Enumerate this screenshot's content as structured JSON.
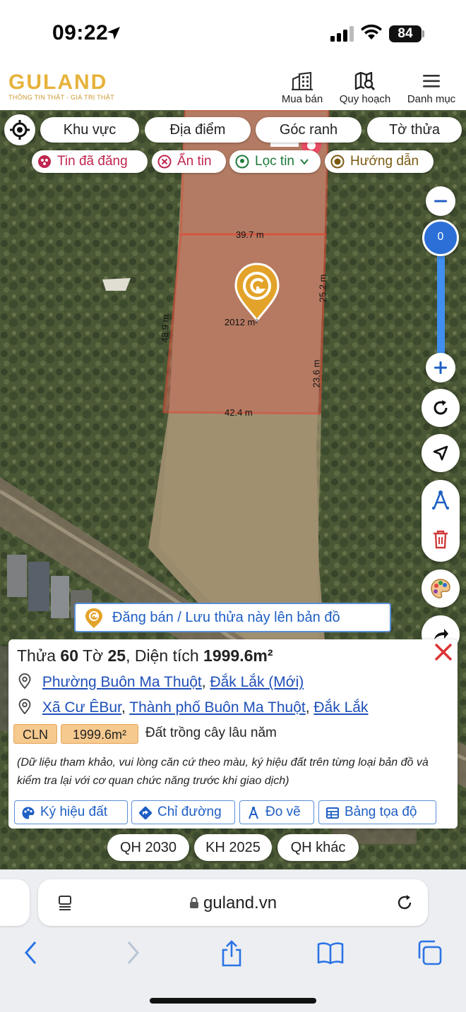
{
  "status": {
    "time": "09:22",
    "battery": "84"
  },
  "header": {
    "logo": "GULAND",
    "tagline": "THÔNG TIN THẬT - GIÁ TRỊ THẬT",
    "nav": [
      {
        "label": "Mua bán",
        "icon": "buildings-icon"
      },
      {
        "label": "Quy hoạch",
        "icon": "map-search-icon"
      },
      {
        "label": "Danh mục",
        "icon": "menu-icon"
      }
    ]
  },
  "filters": [
    "Khu vực",
    "Địa điểm",
    "Góc ranh",
    "Tờ thửa"
  ],
  "chips": [
    "Tin đã đăng",
    "Ẩn tin",
    "Lọc tin",
    "Hướng dẫn"
  ],
  "map": {
    "zoom_value": "0",
    "dimensions": {
      "top": "39.7 m",
      "right_upper": "25.2 m",
      "right_lower": "23.6 m",
      "left": "48.9 m",
      "bottom": "42.4 m"
    },
    "area_label": "2012 m²",
    "post_banner": "Đăng bán / Lưu thửa này lên bản đồ"
  },
  "card": {
    "title_parts": {
      "p1": "Thửa ",
      "parcel": "60",
      "p2": " Tờ ",
      "sheet": "25",
      "p3": ", Diện tích ",
      "area": "1999.6m²"
    },
    "address_new": {
      "ward": "Phường Buôn Ma Thuột",
      "sep": ", ",
      "province": "Đắk Lắk (Mới)"
    },
    "address_old": {
      "commune": "Xã Cư ÊBur",
      "sep1": ", ",
      "city": "Thành phố Buôn Ma Thuột",
      "sep2": ", ",
      "province": "Đắk Lắk"
    },
    "land_code": "CLN",
    "land_area": "1999.6m²",
    "land_use": "Đất trồng cây lâu năm",
    "note": "(Dữ liệu tham khảo, vui lòng căn cứ theo màu, ký hiệu đất trên từng loại bản đồ và kiểm tra lại với cơ quan chức năng trước khi giao dịch)",
    "actions": [
      "Ký hiệu đất",
      "Chỉ đường",
      "Đo vẽ",
      "Bảng tọa độ"
    ]
  },
  "plans": [
    "QH 2030",
    "KH 2025",
    "QH khác"
  ],
  "browser": {
    "url": "guland.vn"
  }
}
